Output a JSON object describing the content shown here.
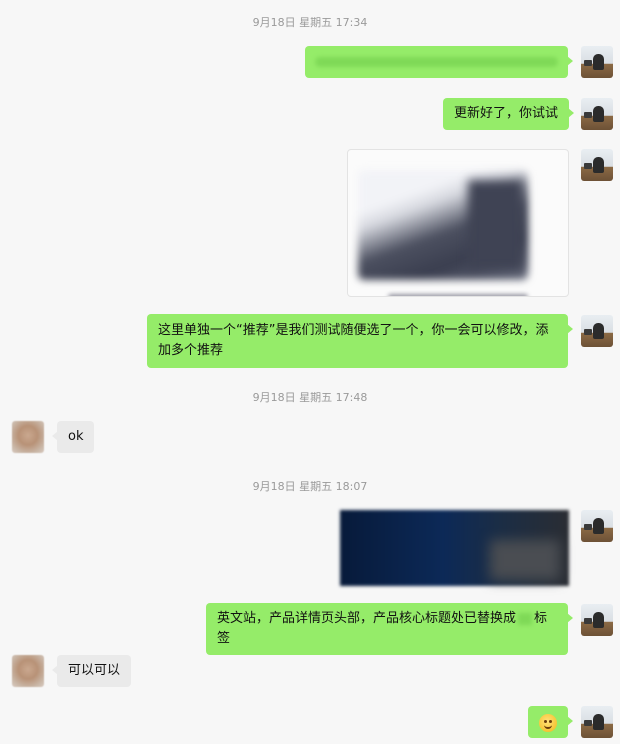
{
  "timestamps": [
    "9月18日 星期五 17:34",
    "9月18日 星期五 17:48",
    "9月18日 星期五 18:07"
  ],
  "messages": {
    "m2": "更新好了，你试试",
    "m4": "这里单独一个“推荐”是我们测试随便选了一个，你一会可以修改，添加多个推荐",
    "m5": "ok",
    "m7_before": "英文站，产品详情页头部，产品核心标题处已替换成",
    "m7_after": "标签",
    "m8": "可以可以"
  },
  "colors": {
    "self_bubble": "#95ec69",
    "other_bubble": "#eaeaea",
    "background": "#f7f7f7"
  },
  "icons": {
    "emoji": "smile-emoji-icon"
  }
}
